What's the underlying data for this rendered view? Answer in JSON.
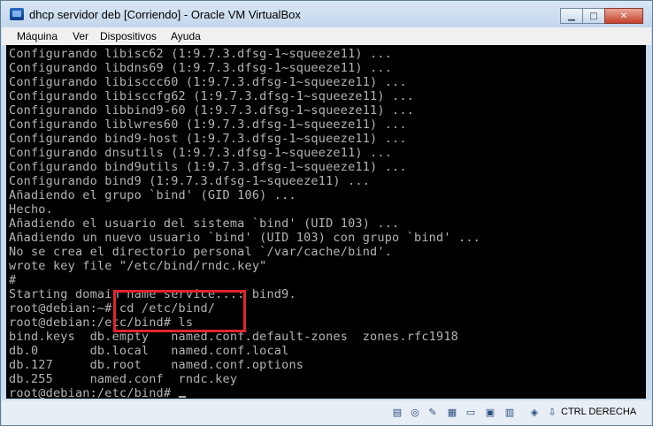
{
  "window": {
    "title": "dhcp servidor deb [Corriendo] - Oracle VM VirtualBox"
  },
  "menu": {
    "items": [
      "Máquina",
      "Ver",
      "Dispositivos",
      "Ayuda"
    ]
  },
  "terminal": {
    "lines": [
      "Configurando libisc62 (1:9.7.3.dfsg-1~squeeze11) ...",
      "Configurando libdns69 (1:9.7.3.dfsg-1~squeeze11) ...",
      "Configurando libisccc60 (1:9.7.3.dfsg-1~squeeze11) ...",
      "Configurando libisccfg62 (1:9.7.3.dfsg-1~squeeze11) ...",
      "Configurando libbind9-60 (1:9.7.3.dfsg-1~squeeze11) ...",
      "Configurando liblwres60 (1:9.7.3.dfsg-1~squeeze11) ...",
      "Configurando bind9-host (1:9.7.3.dfsg-1~squeeze11) ...",
      "Configurando dnsutils (1:9.7.3.dfsg-1~squeeze11) ...",
      "Configurando bind9utils (1:9.7.3.dfsg-1~squeeze11) ...",
      "Configurando bind9 (1:9.7.3.dfsg-1~squeeze11) ...",
      "Añadiendo el grupo `bind' (GID 106) ...",
      "Hecho.",
      "Añadiendo el usuario del sistema `bind' (UID 103) ...",
      "Añadiendo un nuevo usuario `bind' (UID 103) con grupo `bind' ...",
      "No se crea el directorio personal `/var/cache/bind'.",
      "wrote key file \"/etc/bind/rndc.key\"",
      "#",
      "Starting domain name service...: bind9.",
      "root@debian:~# cd /etc/bind/",
      "root@debian:/etc/bind# ls",
      "bind.keys  db.empty   named.conf.default-zones  zones.rfc1918",
      "db.0       db.local   named.conf.local",
      "db.127     db.root    named.conf.options",
      "db.255     named.conf  rndc.key",
      "root@debian:/etc/bind# "
    ]
  },
  "statusbar": {
    "host_key_label": "CTRL DERECHA",
    "icons": [
      "hard-disk-icon",
      "optical-drive-icon",
      "usb-icon",
      "shared-folders-icon",
      "display-icon",
      "video-capture-icon",
      "network-icon",
      "mouse-integration-icon",
      "host-key-arrow-icon"
    ]
  },
  "colors": {
    "terminal_bg": "#000000",
    "terminal_fg": "#b4b4b4",
    "highlight_border": "#e0252c",
    "title_bar": "#c9dbee"
  }
}
